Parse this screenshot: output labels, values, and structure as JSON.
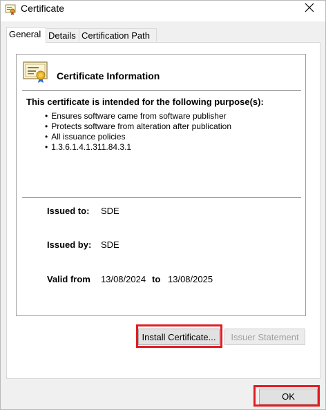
{
  "window": {
    "title": "Certificate"
  },
  "tabs": [
    {
      "label": "General"
    },
    {
      "label": "Details"
    },
    {
      "label": "Certification Path"
    }
  ],
  "general": {
    "heading": "Certificate Information",
    "purpose_title": "This certificate is intended for the following purpose(s):",
    "purposes": [
      "Ensures software came from software publisher",
      "Protects software from alteration after publication",
      "All issuance policies",
      "1.3.6.1.4.1.311.84.3.1"
    ],
    "issued_to_label": "Issued to:",
    "issued_to": "SDE",
    "issued_by_label": "Issued by:",
    "issued_by": "SDE",
    "valid_from_label": "Valid from",
    "valid_from": "13/08/2024",
    "valid_to_label": "to",
    "valid_to": "13/08/2025"
  },
  "buttons": {
    "install": "Install Certificate...",
    "issuer_statement": "Issuer Statement",
    "ok": "OK"
  },
  "icons": {
    "app": "certificate-icon",
    "close": "close-icon",
    "certificate": "certificate-icon"
  },
  "colors": {
    "highlight": "#e11b22",
    "disabled_text": "#a0a0a0"
  }
}
